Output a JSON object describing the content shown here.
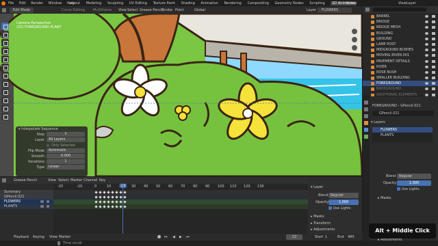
{
  "topbar": {
    "menus": [
      "File",
      "Edit",
      "Render",
      "Window",
      "Help"
    ],
    "workspaces": [
      "Layout",
      "Modeling",
      "Sculpting",
      "UV Editing",
      "Texture Paint",
      "Shading",
      "Animation",
      "Rendering",
      "Compositing",
      "Geometry Nodes",
      "Scripting",
      "2D Animation"
    ],
    "scene": "Scene",
    "view_layer": "ViewLayer"
  },
  "header": {
    "mode": "Edit Mode",
    "items": [
      "Curve Editing",
      "Multiframe",
      "View",
      "Select",
      "Grease Pencil",
      "Stroke",
      "Point"
    ],
    "orientation": "Global",
    "layer_label": "Layer",
    "layer_value": "FLOWERS"
  },
  "viewport": {
    "camera": "Camera Perspective",
    "object": "(22) FOREGROUND PLANT"
  },
  "operator": {
    "title": "Interpolate Sequence",
    "step_label": "Step",
    "step": "1",
    "layer_label": "Layer",
    "layer": "All Layers",
    "only_selected": "Only Selected",
    "flip_label": "Flip Mode",
    "flip": "Automatic",
    "smooth_label": "Smooth",
    "smooth": "0.000",
    "iter_label": "Iterations",
    "iter": "1",
    "type_label": "Type",
    "type": "Linear"
  },
  "outliner": {
    "items": [
      "BARREL",
      "BRIDGE",
      "BRIDGE MESH",
      "BUILDING",
      "GROUND",
      "LAMP POST",
      "MIDGROUND BUSHES",
      "MOVING RIVER.001",
      "PAVEMENT DETAILS",
      "RIVER",
      "ROSE BUSH",
      "SMALLER BUILDING",
      "FOREGROUND",
      "BACKGROUND",
      "ADDITIONAL ELEMENTS"
    ],
    "selected": "FOREGROUND"
  },
  "properties": {
    "breadcrumb": "FOREGROUND",
    "data": "GPencil.021",
    "object_name": "GPencil.021",
    "layers_label": "Layers",
    "layers": [
      "FLOWERS",
      "PLANTS"
    ],
    "blend_label": "Blend",
    "blend": "Regular",
    "opacity_label": "Opacity",
    "opacity": "1.000",
    "use_lights": "Use Lights",
    "masks": "Masks"
  },
  "timeline": {
    "editor": "Grease Pencil",
    "menus": [
      "View",
      "Select",
      "Marker",
      "Channel",
      "Key"
    ],
    "ticks": [
      "-20",
      "-10",
      "0",
      "10",
      "20",
      "22",
      "30",
      "40",
      "50",
      "60",
      "70",
      "80",
      "90",
      "100",
      "110",
      "120",
      "130"
    ],
    "current": "22",
    "summary": "Summary",
    "object": "GPencil.021",
    "layers": [
      "FLOWERS",
      "PLANTS"
    ]
  },
  "layer_panel": {
    "title": "Layer",
    "blend_label": "Blend",
    "blend": "Regular",
    "opacity_label": "Opacity",
    "opacity": "1.000",
    "use_lights": "Use Lights",
    "masks": "Masks",
    "transform": "Transform",
    "adjustments": "Adjustments"
  },
  "playback": {
    "playback": "Playback",
    "keying": "Keying",
    "view": "View",
    "marker": "Marker",
    "frame": "22",
    "start_label": "Start",
    "start": "1",
    "end_label": "End",
    "end": "480",
    "status": "Time scrub"
  },
  "overlay": {
    "shortcut": "Alt + Middle Click"
  },
  "side_adjustments": "Adjustments",
  "colors": {
    "accent": "#4772b3",
    "grass": "#7bc642",
    "flower_yellow": "#f5e23a",
    "outline": "#3a2415",
    "sky": "#7fd6f0"
  }
}
